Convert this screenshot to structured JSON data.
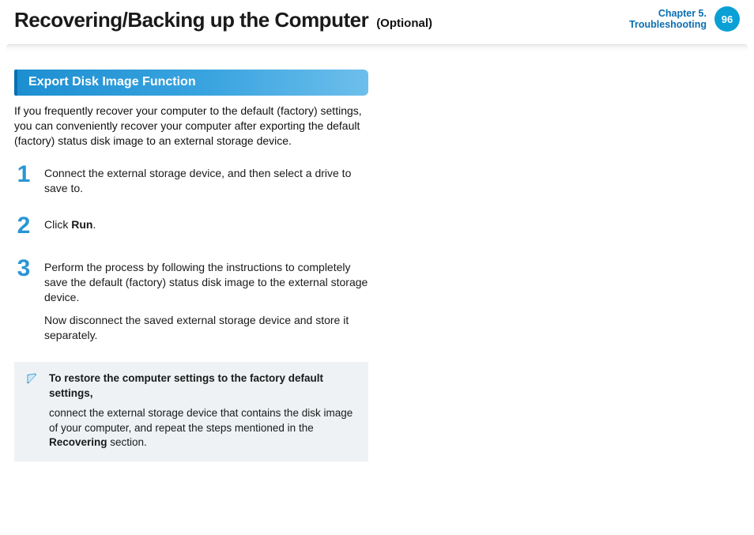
{
  "header": {
    "title": "Recovering/Backing up the Computer",
    "suffix": "(Optional)",
    "chapter_line1": "Chapter 5.",
    "chapter_line2": "Troubleshooting",
    "page_number": "96"
  },
  "section": {
    "title": "Export Disk Image Function",
    "intro": "If you frequently recover your computer to the default (factory) settings, you can conveniently recover your computer after exporting the default (factory) status disk image to an external storage device."
  },
  "steps": [
    {
      "n": "1",
      "paras": [
        "Connect the external storage device, and then select a drive to save to."
      ]
    },
    {
      "n": "2",
      "paras": [
        "Click <b>Run</b>."
      ]
    },
    {
      "n": "3",
      "paras": [
        "Perform the process by following the instructions to completely save the default (factory) status disk image to the external storage device.",
        "Now disconnect the saved external storage device and store it separately."
      ]
    }
  ],
  "note": {
    "title": "To restore the computer settings to the factory default settings,",
    "body": "connect the external storage device that contains the disk image of your computer, and repeat the steps mentioned in the <b>Recovering</b> section."
  }
}
